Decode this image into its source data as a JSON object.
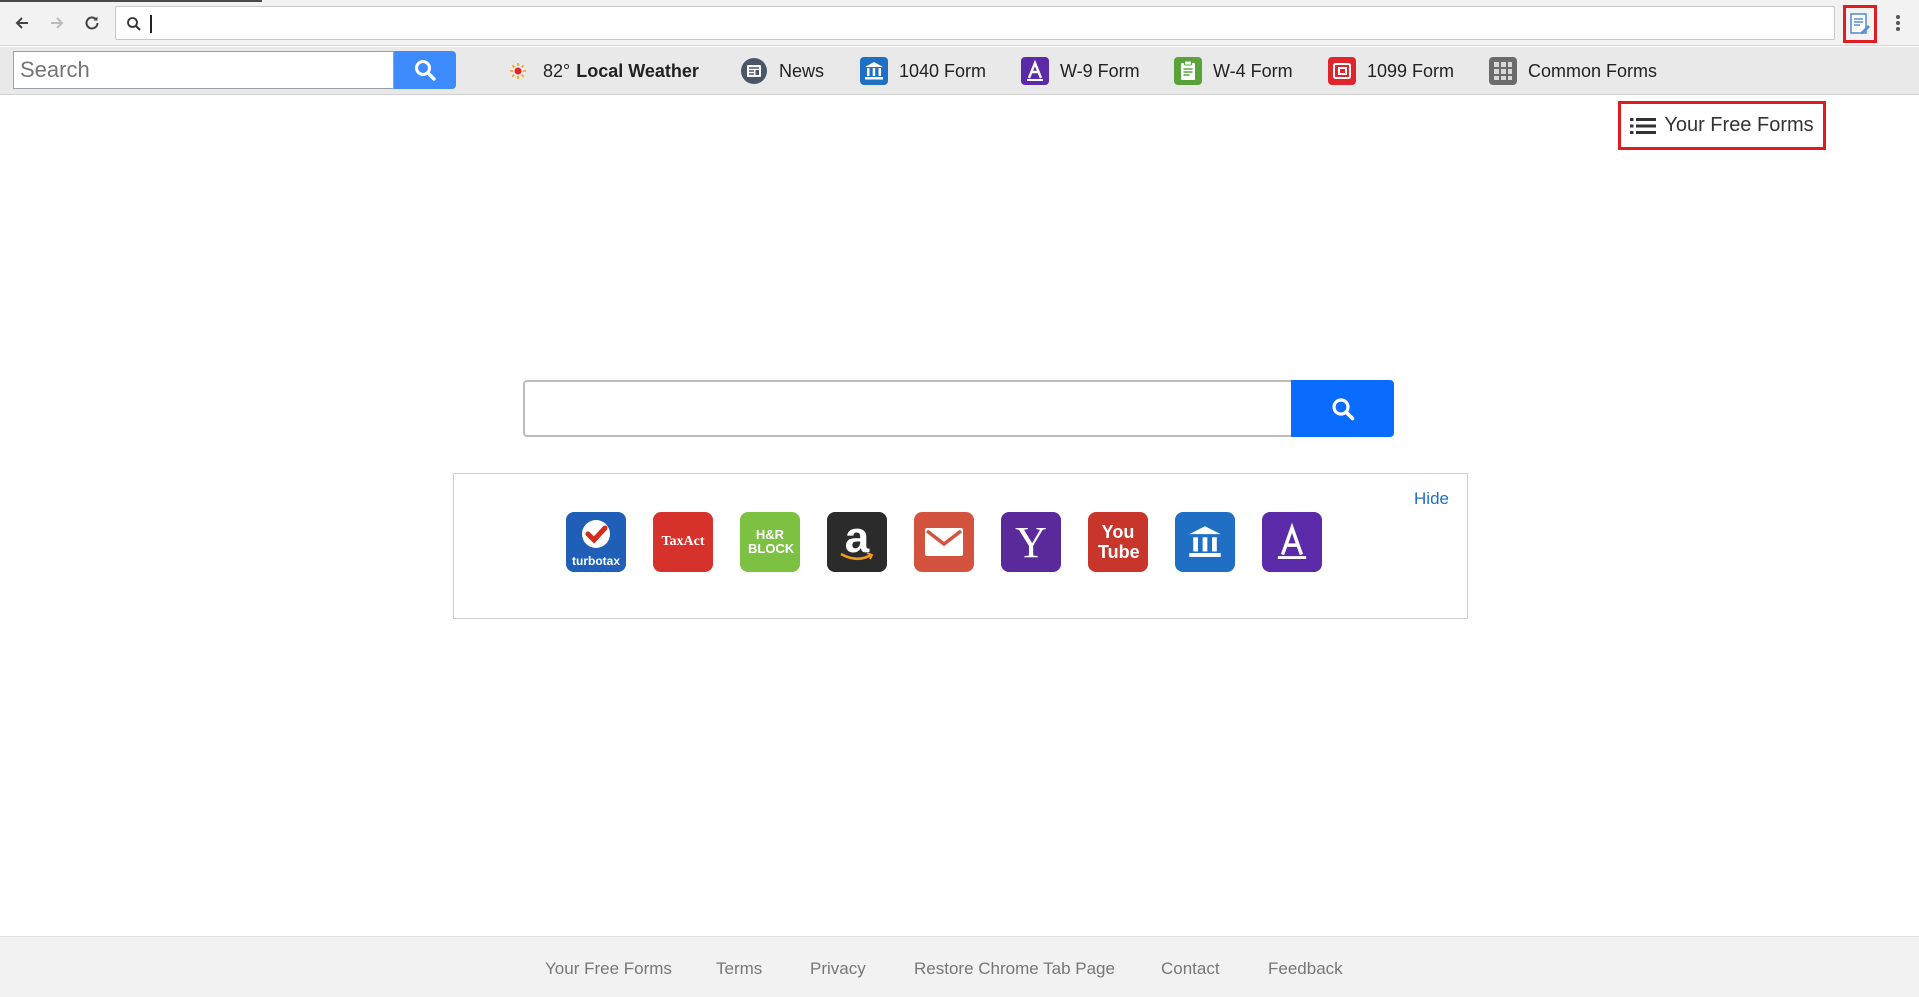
{
  "browser": {
    "address_value": "",
    "extension_icon": "form-edit-icon"
  },
  "toolbar": {
    "search_placeholder": "Search",
    "weather": {
      "temp": "82°",
      "label": "Local Weather"
    },
    "links": [
      {
        "label": "News",
        "icon": "news-icon"
      },
      {
        "label": "1040 Form",
        "icon": "bank-icon"
      },
      {
        "label": "W-9 Form",
        "icon": "letter-a-icon"
      },
      {
        "label": "W-4 Form",
        "icon": "clipboard-icon"
      },
      {
        "label": "1099 Form",
        "icon": "receipt-icon"
      },
      {
        "label": "Common Forms",
        "icon": "forms-grid-icon"
      }
    ]
  },
  "page": {
    "menu_button_label": "Your Free Forms",
    "hide_label": "Hide",
    "tiles": [
      {
        "name": "turbotax",
        "text": "turbotax",
        "color": "#1f5fb8"
      },
      {
        "name": "taxact",
        "text": "TaxAct",
        "color": "#d6322b"
      },
      {
        "name": "hr-block",
        "text": "H&R BLOCK",
        "color": "#7dc143"
      },
      {
        "name": "amazon",
        "text": "a",
        "color": "#2b2b2b"
      },
      {
        "name": "mail",
        "text": "",
        "color": "#d4533f"
      },
      {
        "name": "yahoo",
        "text": "Y",
        "color": "#5b2a9a"
      },
      {
        "name": "youtube",
        "text": "You Tube",
        "color": "#c7352b"
      },
      {
        "name": "bank",
        "text": "",
        "color": "#1f6fc5"
      },
      {
        "name": "letter-a",
        "text": "A",
        "color": "#5b2aa8"
      }
    ]
  },
  "footer": {
    "links": [
      "Your Free Forms",
      "Terms",
      "Privacy",
      "Restore Chrome Tab Page",
      "Contact",
      "Feedback"
    ]
  },
  "colors": {
    "accent_blue": "#0a6cff",
    "highlight_red": "#e01b22",
    "link_blue": "#1f6fc5"
  }
}
